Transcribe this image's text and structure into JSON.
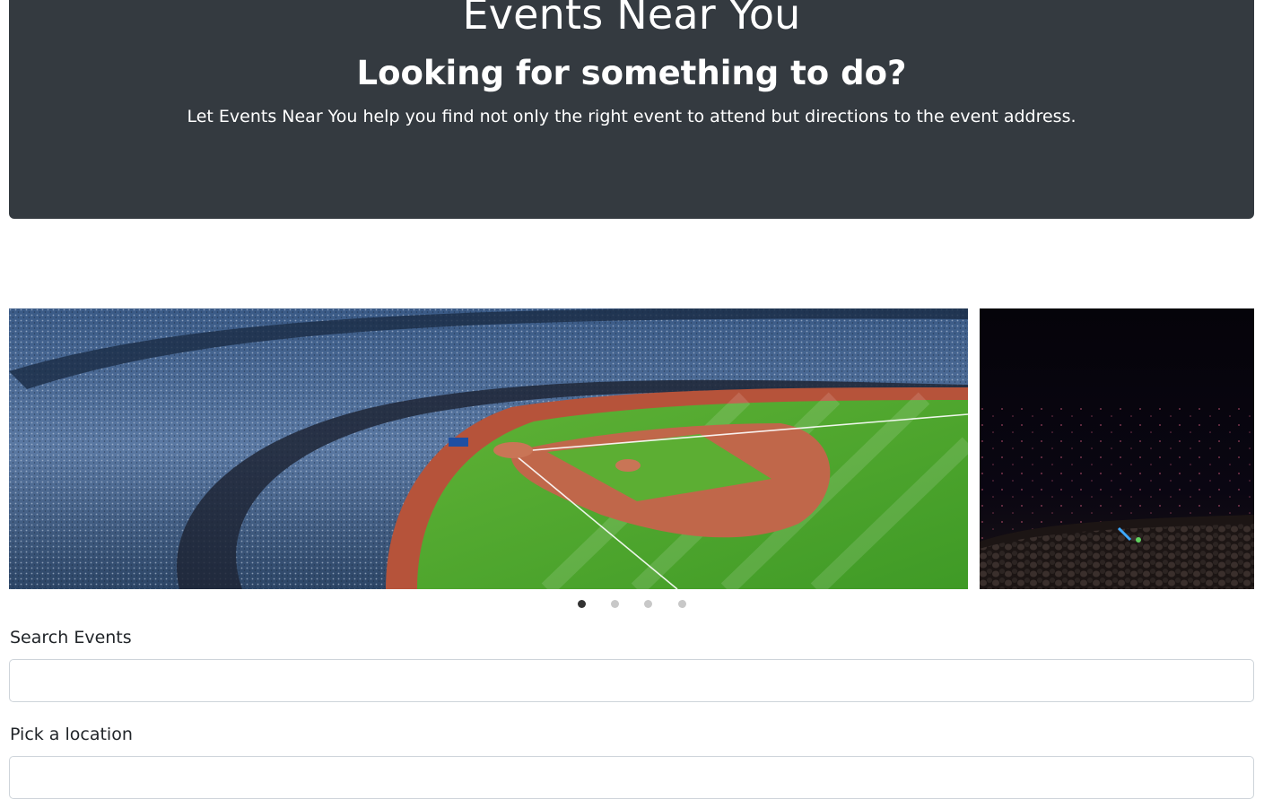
{
  "hero": {
    "title": "Events Near You",
    "subtitle": "Looking for something to do?",
    "lead": "Let Events Near You help you find not only the right event to attend but directions to the event address.",
    "background_color": "#343a40"
  },
  "carousel": {
    "slides": [
      {
        "image": "baseball-stadium-aerial",
        "active": true
      },
      {
        "image": "concert-crowd-dark",
        "active": false
      }
    ],
    "indicator_count": 4,
    "active_indicator": 1
  },
  "search": {
    "label": "Search Events",
    "value": "",
    "placeholder": ""
  },
  "location": {
    "label": "Pick a location",
    "value": "",
    "placeholder": ""
  }
}
